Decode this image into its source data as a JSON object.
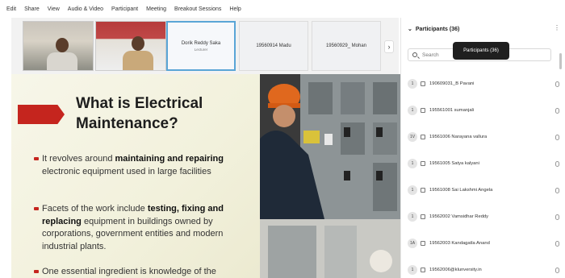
{
  "menu": [
    "Edit",
    "Share",
    "View",
    "Audio & Video",
    "Participant",
    "Meeting",
    "Breakout Sessions",
    "Help"
  ],
  "video_tiles": [
    {
      "name": "Dorik Reddy Saka",
      "subtitle": "Lecturer",
      "active": true
    },
    {
      "name": "19560914 Madu",
      "subtitle": "",
      "active": false
    },
    {
      "name": "19560929_ Mohan",
      "subtitle": "",
      "active": false
    }
  ],
  "slide": {
    "title_line1": "What is Electrical",
    "title_line2": "Maintenance?",
    "bullet1_pre": "It revolves around ",
    "bullet1_bold": "maintaining and repairing",
    "bullet1_post": " electronic equipment used in large facilities",
    "bullet2_pre": "Facets of the work include ",
    "bullet2_bold": "testing, fixing and replacing",
    "bullet2_post": " equipment in buildings owned by corporations, government entities and modern industrial plants.",
    "bullet3_pre": "One essential ingredient is knowledge of the"
  },
  "panel": {
    "title": "Participants (36)",
    "search_placeholder": "Search",
    "tooltip": "Participants (36)"
  },
  "participants": [
    {
      "avatar": "1",
      "name": "190609031_B Pavani"
    },
    {
      "avatar": "1",
      "name": "195561001 sumanjali"
    },
    {
      "avatar": "1V",
      "name": "19561006 Narayana vallura"
    },
    {
      "avatar": "1",
      "name": "19561005 Satya kalyani"
    },
    {
      "avatar": "1",
      "name": "19561008 Sai Lakshmi Angela"
    },
    {
      "avatar": "1",
      "name": "19562002 Vamsidhar Reddy"
    },
    {
      "avatar": "1A",
      "name": "19562003 Kandagatla Anand"
    },
    {
      "avatar": "1",
      "name": "19562006@klunversity.in"
    }
  ]
}
